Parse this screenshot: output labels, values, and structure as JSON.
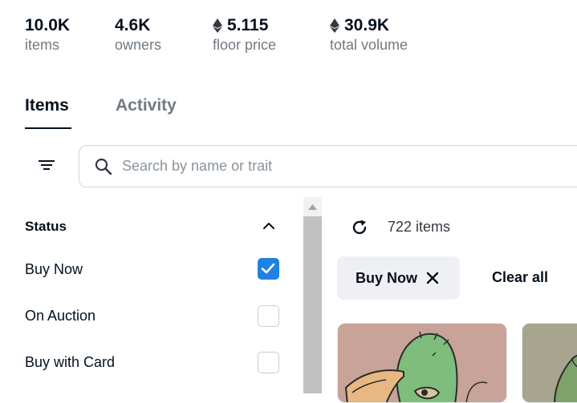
{
  "stats": [
    {
      "value": "10.0K",
      "label": "items",
      "eth": false
    },
    {
      "value": "4.6K",
      "label": "owners",
      "eth": false
    },
    {
      "value": "5.115",
      "label": "floor price",
      "eth": true
    },
    {
      "value": "30.9K",
      "label": "total volume",
      "eth": true
    }
  ],
  "tabs": {
    "items": "Items",
    "activity": "Activity"
  },
  "search": {
    "placeholder": "Search by name or trait"
  },
  "sidebar": {
    "status_title": "Status",
    "filters": [
      {
        "label": "Buy Now",
        "checked": true
      },
      {
        "label": "On Auction",
        "checked": false
      },
      {
        "label": "Buy with Card",
        "checked": false
      }
    ]
  },
  "results": {
    "count": "722 items",
    "active_filter": "Buy Now",
    "clear_all": "Clear all"
  },
  "colors": {
    "accent": "#2081e2",
    "text": "#04111d",
    "muted": "#707a83",
    "chip_bg": "#eef0f3"
  },
  "icons": [
    "ethereum-icon",
    "filter-icon",
    "search-icon",
    "chevron-up-icon",
    "check-icon",
    "refresh-icon",
    "close-icon"
  ]
}
